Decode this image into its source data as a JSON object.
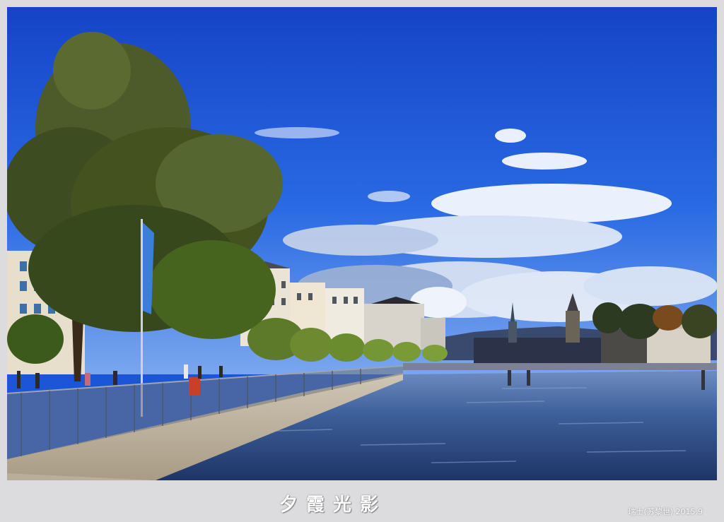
{
  "caption": {
    "title": "夕霞光影",
    "credit": "瑞士(苏黎世) 2015.9"
  },
  "photo": {
    "subject": "",
    "colors": {
      "sky_top": "#1445c8",
      "sky_bottom": "#5a8ff0",
      "water": "#3d5f9a",
      "frame": "#dcdcde"
    }
  }
}
